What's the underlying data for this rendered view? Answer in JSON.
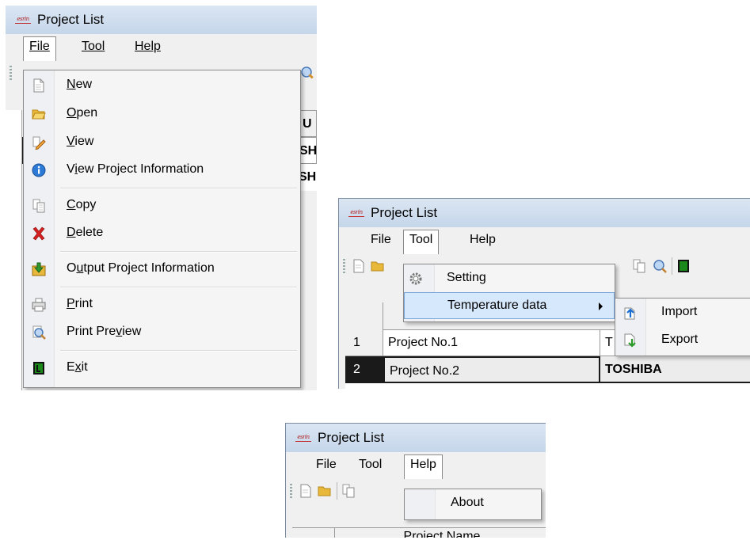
{
  "app": {
    "title": "Project List",
    "logo_text": "esrin"
  },
  "menubar": {
    "file": "File",
    "tool": "Tool",
    "help": "Help"
  },
  "file_menu": {
    "items": [
      {
        "pre": "",
        "key": "N",
        "post": "ew",
        "icon": "new-document-icon"
      },
      {
        "pre": "",
        "key": "O",
        "post": "pen",
        "icon": "open-folder-icon"
      },
      {
        "pre": "",
        "key": "V",
        "post": "iew",
        "icon": "edit-pencil-icon"
      },
      {
        "pre": "V",
        "key": "i",
        "post": "ew Project Information",
        "icon": "info-icon"
      },
      {
        "pre": "",
        "key": "C",
        "post": "opy",
        "icon": "copy-icon"
      },
      {
        "pre": "",
        "key": "D",
        "post": "elete",
        "icon": "delete-x-icon"
      },
      {
        "pre": "O",
        "key": "u",
        "post": "tput Project Information",
        "icon": "output-download-icon"
      },
      {
        "pre": "",
        "key": "P",
        "post": "rint",
        "icon": "printer-icon"
      },
      {
        "pre": "Print Pre",
        "key": "v",
        "post": "iew",
        "icon": "print-preview-icon"
      },
      {
        "pre": "E",
        "key": "x",
        "post": "it",
        "icon": "exit-icon"
      }
    ],
    "partial_header": "U",
    "partial_cell_1": "SHI",
    "partial_cell_2": "SHI"
  },
  "tool_menu": {
    "setting": "Setting",
    "temperature_data": "Temperature data",
    "submenu": {
      "import": "Import",
      "export": "Export"
    }
  },
  "grid": {
    "rows": [
      {
        "num": "1",
        "name": "Project No.1",
        "maker": "T"
      },
      {
        "num": "2",
        "name": "Project No.2",
        "maker": "TOSHIBA"
      }
    ]
  },
  "help_menu": {
    "about": "About"
  },
  "help_grid": {
    "header_name": "Project Name"
  },
  "colors": {
    "title_bar": "#c5d6ea",
    "menu_highlight": "#d6e8fb",
    "selected_row_marker": "#1a1a1a",
    "exit_icon": "#1b8a1b"
  }
}
